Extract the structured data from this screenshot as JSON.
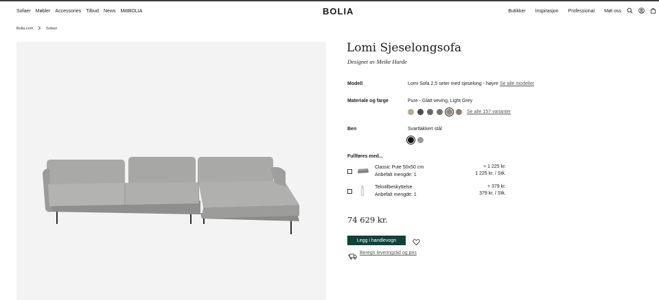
{
  "header": {
    "nav_left": [
      "Sofaer",
      "Møbler",
      "Accessories",
      "Tilbud",
      "News",
      "MittBOLIA"
    ],
    "logo": "BOLIA",
    "nav_right": [
      "Butikker",
      "Inspirasjon",
      "Professional",
      "Møt oss"
    ],
    "icons": [
      "search-icon",
      "user-icon",
      "bag-icon"
    ]
  },
  "breadcrumb": {
    "items": [
      "Bolia.com",
      "Sofaer"
    ]
  },
  "product": {
    "title": "Lomi Sjeselongsofa",
    "designer": "Designet av Meike Harde",
    "model": {
      "label": "Modell",
      "value": "Lomi Sofa 2,5 seter med sjeselong - høyre",
      "link": "Se alle modeller"
    },
    "material": {
      "label": "Materiale og farge",
      "value": "Pure - Glatt veving, Light Grey",
      "swatches": [
        "#b7aa96",
        "#4a4d4b",
        "#656965",
        "#7c7266",
        "#8d8a84",
        "#8e7d6e"
      ],
      "selected_index": 4,
      "link": "Se alle 157 varianter"
    },
    "legs": {
      "label": "Ben",
      "value": "Svartlakkert stål",
      "swatches": [
        "#111111",
        "#9a9a9a"
      ],
      "selected_index": 0
    },
    "accessories_heading": "Fullføres med...",
    "accessories": [
      {
        "name": "Classic Pute 50x50 cm",
        "qty": "Anbefalt mengde: 1",
        "price_add": "+ 1 225 kr.",
        "unit_price": "1 225 kr. / Stk.",
        "checked": false
      },
      {
        "name": "Tekstilbeskyttelse",
        "qty": "Anbefalt mengde: 1",
        "price_add": "+ 379 kr.",
        "unit_price": "379 kr. / Stk.",
        "checked": false
      }
    ],
    "price": "74 629 kr.",
    "add_to_cart": "Legg i handlevogn",
    "delivery_link": "Beregn leveringstid og pris"
  },
  "colors": {
    "accent": "#10413a",
    "image_bg": "#f3f3f3",
    "sofa": "#a9a9a7"
  }
}
